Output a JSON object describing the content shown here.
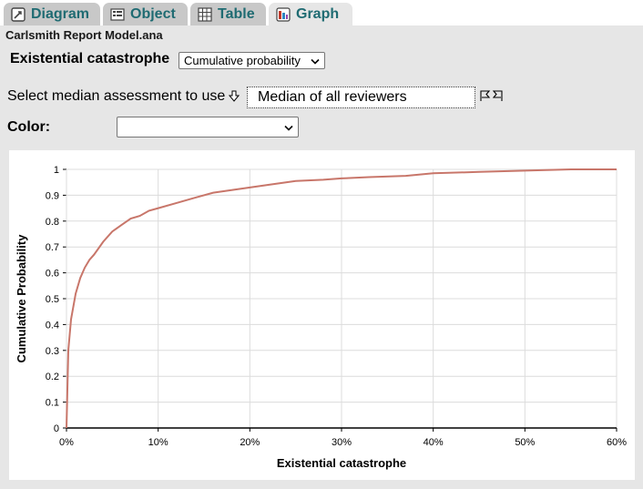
{
  "tabs": [
    {
      "label": "Diagram",
      "icon": "diagram-icon",
      "active": false
    },
    {
      "label": "Object",
      "icon": "object-icon",
      "active": false
    },
    {
      "label": "Table",
      "icon": "table-icon",
      "active": false
    },
    {
      "label": "Graph",
      "icon": "graph-icon",
      "active": true
    }
  ],
  "model_title": "Carlsmith Report Model.ana",
  "variable": {
    "title": "Existential catastrophe",
    "view_select": "Cumulative probability"
  },
  "median": {
    "label": "Select median assessment to use",
    "value": "Median of all reviewers"
  },
  "color": {
    "label": "Color:",
    "value": ""
  },
  "colors": {
    "accent": "#1f6b72",
    "curve": "#c8766a"
  },
  "chart_data": {
    "type": "line",
    "xlabel": "Existential catastrophe",
    "ylabel": "Cumulative Probability",
    "xlim": [
      0,
      0.6
    ],
    "ylim": [
      0,
      1
    ],
    "x_ticks": [
      "0%",
      "10%",
      "20%",
      "30%",
      "40%",
      "50%",
      "60%"
    ],
    "y_ticks": [
      "0",
      "0.1",
      "0.2",
      "0.3",
      "0.4",
      "0.5",
      "0.6",
      "0.7",
      "0.8",
      "0.9",
      "1"
    ],
    "grid": true,
    "series": [
      {
        "x": [
          0,
          0.002,
          0.005,
          0.01,
          0.015,
          0.02,
          0.025,
          0.03,
          0.04,
          0.05,
          0.06,
          0.07,
          0.08,
          0.09,
          0.1,
          0.12,
          0.14,
          0.16,
          0.18,
          0.2,
          0.22,
          0.25,
          0.28,
          0.3,
          0.33,
          0.37,
          0.4,
          0.45,
          0.5,
          0.55,
          0.6
        ],
        "y": [
          0,
          0.3,
          0.42,
          0.52,
          0.58,
          0.62,
          0.65,
          0.67,
          0.72,
          0.76,
          0.785,
          0.81,
          0.82,
          0.84,
          0.85,
          0.87,
          0.89,
          0.91,
          0.92,
          0.93,
          0.94,
          0.955,
          0.96,
          0.965,
          0.97,
          0.975,
          0.985,
          0.99,
          0.995,
          1.0,
          1.0
        ]
      }
    ]
  }
}
